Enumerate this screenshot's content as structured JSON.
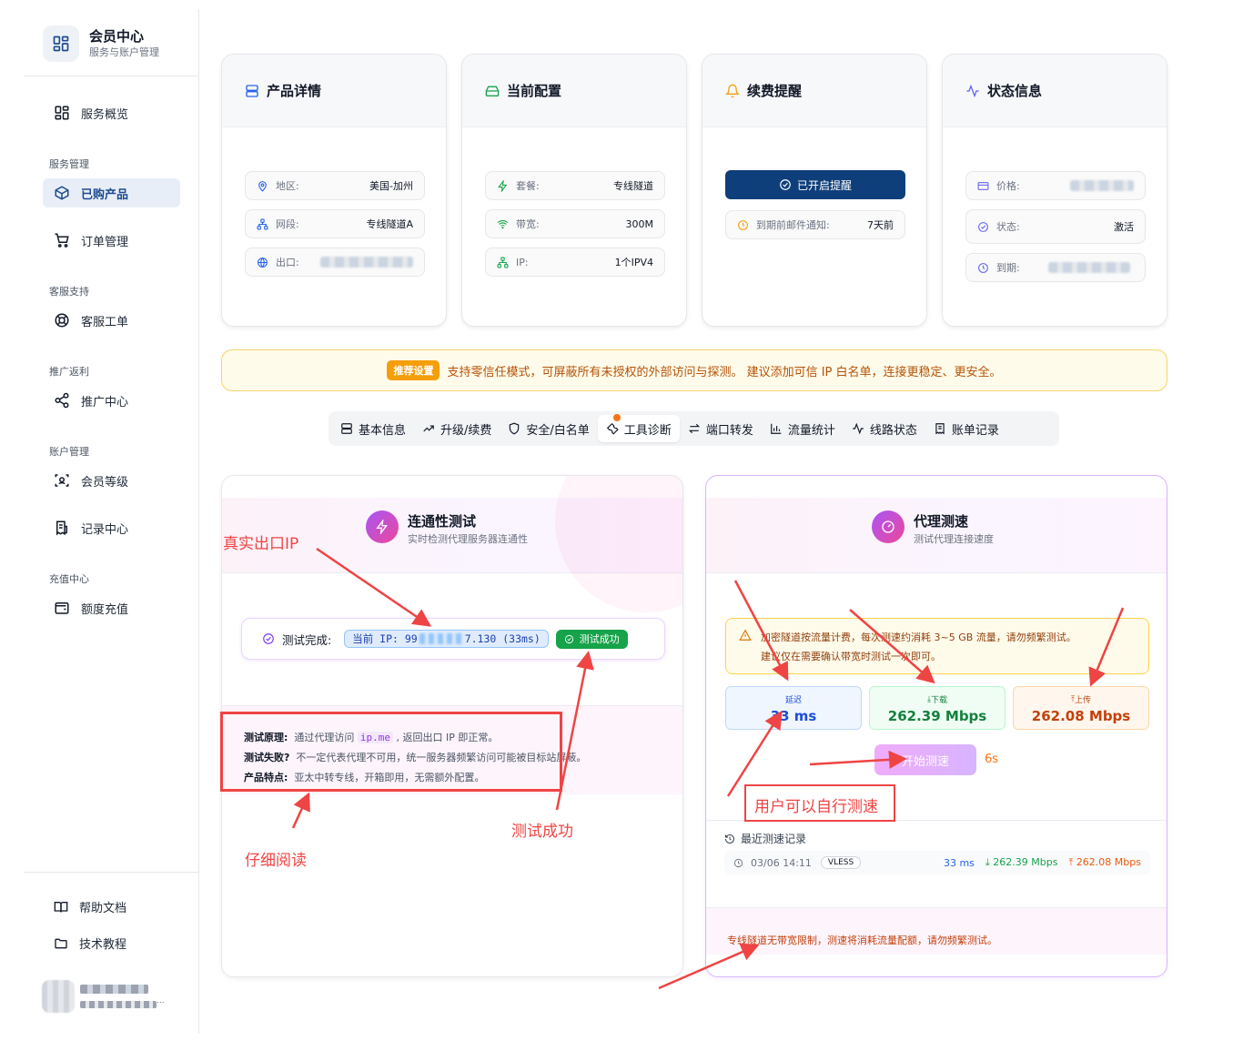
{
  "brand": {
    "title": "会员中心",
    "subtitle": "服务与账户管理"
  },
  "sidebar": {
    "overview": "服务概览",
    "sections": [
      {
        "title": "服务管理",
        "items": [
          "已购产品",
          "订单管理"
        ]
      },
      {
        "title": "客服支持",
        "items": [
          "客服工单"
        ]
      },
      {
        "title": "推广返利",
        "items": [
          "推广中心"
        ]
      },
      {
        "title": "账户管理",
        "items": [
          "会员等级",
          "记录中心"
        ]
      },
      {
        "title": "充值中心",
        "items": [
          "额度充值"
        ]
      }
    ],
    "bottom": [
      "帮助文档",
      "技术教程"
    ],
    "user_mail_fragment": "..."
  },
  "cards": {
    "product": {
      "title": "产品详情",
      "rows": [
        {
          "label": "地区:",
          "value": "美国-加州"
        },
        {
          "label": "网段:",
          "value": "专线隧道A"
        },
        {
          "label": "出口:",
          "value": ""
        }
      ]
    },
    "config": {
      "title": "当前配置",
      "rows": [
        {
          "label": "套餐:",
          "value": "专线隧道"
        },
        {
          "label": "带宽:",
          "value": "300M"
        },
        {
          "label": "IP:",
          "value": "1个IPV4"
        }
      ]
    },
    "renew": {
      "title": "续费提醒",
      "button": "已开启提醒",
      "rows": [
        {
          "label": "到期前邮件通知:",
          "value": "7天前"
        }
      ]
    },
    "status": {
      "title": "状态信息",
      "rows": [
        {
          "label": "价格:",
          "value": ""
        },
        {
          "label": "状态:",
          "value": "激活"
        },
        {
          "label": "到期:",
          "value": ""
        }
      ]
    }
  },
  "banner": {
    "badge": "推荐设置",
    "text": "支持零信任模式，可屏蔽所有未授权的外部访问与探测。 建议添加可信 IP 白名单，连接更稳定、更安全。"
  },
  "tabs": [
    "基本信息",
    "升级/续费",
    "安全/白名单",
    "工具诊断",
    "端口转发",
    "流量统计",
    "线路状态",
    "账单记录"
  ],
  "active_tab": "工具诊断",
  "connectivity": {
    "title": "连通性测试",
    "subtitle": "实时检测代理服务器连通性",
    "status_label": "测试完成:",
    "ip_prefix": "当前 IP: 99",
    "ip_suffix": "7.130 (33ms)",
    "ok_label": "测试成功",
    "info": [
      {
        "label": "测试原理:",
        "pre": "通过代理访问",
        "code": "ip.me",
        "post": ", 返回出口 IP 即正常。"
      },
      {
        "label": "测试失败?",
        "pre": "不一定代表代理不可用，统一服务器频繁访问可能被目标站屏蔽。",
        "code": "",
        "post": ""
      },
      {
        "label": "产品特点:",
        "pre": "亚太中转专线，开箱即用，无需额外配置。",
        "code": "",
        "post": ""
      }
    ]
  },
  "speedtest": {
    "title": "代理测速",
    "subtitle": "测试代理连接速度",
    "warn1": "加密隧道按流量计费，每次测速约消耗 3~5 GB 流量，请勿频繁测试。",
    "warn2": "建议仅在需要确认带宽时测试一次即可。",
    "latency": {
      "label": "延迟",
      "value": "33 ms"
    },
    "download": {
      "label": "下载",
      "value": "262.39 Mbps"
    },
    "upload": {
      "label": "上传",
      "value": "262.08 Mbps"
    },
    "start_button": "开始测速",
    "countdown": "6s",
    "history_title": "最近测速记录",
    "history": {
      "time": "03/06 14:11",
      "protocol": "VLESS",
      "latency": "33 ms",
      "download": "262.39 Mbps",
      "upload": "262.08 Mbps"
    },
    "footer": "专线隧道无带宽限制，测速将消耗流量配额，请勿频繁测试。"
  },
  "annotations": {
    "real_ip": "真实出口IP",
    "read": "仔细阅读",
    "success": "测试成功",
    "self_test": "用户可以自行测速"
  },
  "colors": {
    "accent": "#0f3f7a",
    "success": "#16a34a",
    "annotation": "#ef4444",
    "warning": "#f59e0b"
  }
}
